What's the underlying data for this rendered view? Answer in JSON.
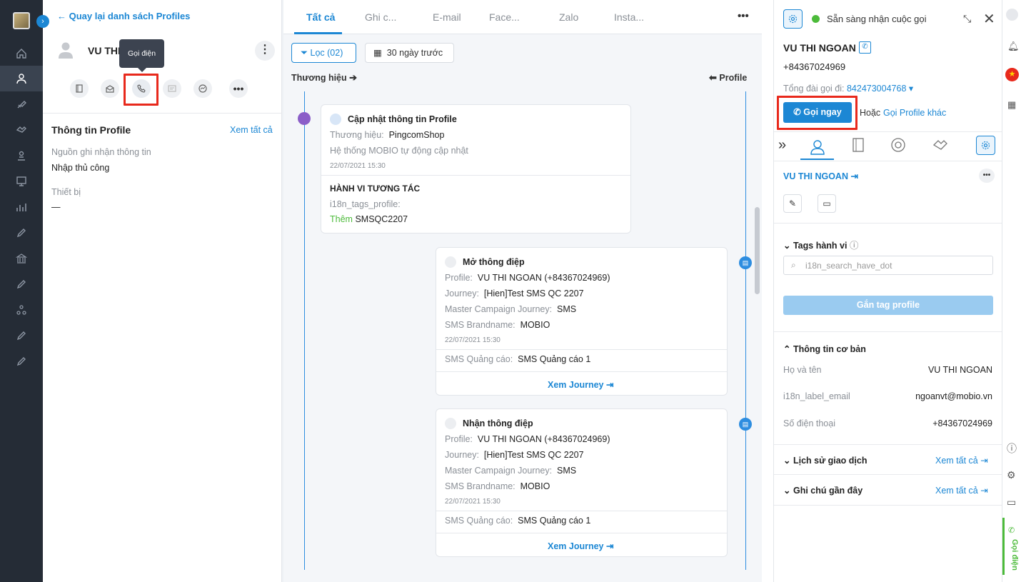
{
  "nav": {
    "back_label": "Quay lại danh sách Profiles"
  },
  "profile": {
    "name_truncated": "VU THI",
    "tooltip": "Gọi điện",
    "info_title": "Thông tin Profile",
    "see_all": "Xem tất cả",
    "source_label": "Nguồn ghi nhận thông tin",
    "source_value": "Nhập thủ công",
    "device_label": "Thiết bị",
    "device_value": "—"
  },
  "tabs": [
    "Tất cả",
    "Ghi c...",
    "E-mail",
    "Face...",
    "Zalo",
    "Insta..."
  ],
  "filters": {
    "filter_label": "Lọc (02)",
    "date_label": "30 ngày trước",
    "brand_label": "Thương hiệu",
    "profile_label": "Profile"
  },
  "timeline": {
    "card1": {
      "title": "Cập nhật thông tin Profile",
      "brand_label": "Thương hiệu:",
      "brand_value": "PingcomShop",
      "desc": "Hệ thống MOBIO tự động cập nhật",
      "time": "22/07/2021 15:30",
      "section_title": "HÀNH VI TƯƠNG TÁC",
      "tags_label": "i18n_tags_profile:",
      "add_label": "Thêm",
      "tag_value": "SMSQC2207"
    },
    "card2": {
      "title": "Mở thông điệp",
      "profile_label": "Profile:",
      "profile_value": "VU THI NGOAN (+84367024969)",
      "journey_label": "Journey:",
      "journey_value": "[Hien]Test SMS QC 2207",
      "master_label": "Master Campaign Journey:",
      "master_value": "SMS",
      "brandname_label": "SMS Brandname:",
      "brandname_value": "MOBIO",
      "time": "22/07/2021 15:30",
      "ad_label": "SMS Quảng cáo:",
      "ad_value": "SMS Quảng cáo 1",
      "link": "Xem Journey"
    },
    "card3": {
      "title": "Nhận thông điệp",
      "profile_label": "Profile:",
      "profile_value": "VU THI NGOAN (+84367024969)",
      "journey_label": "Journey:",
      "journey_value": "[Hien]Test SMS QC 2207",
      "master_label": "Master Campaign Journey:",
      "master_value": "SMS",
      "brandname_label": "SMS Brandname:",
      "brandname_value": "MOBIO",
      "time": "22/07/2021 15:30",
      "ad_label": "SMS Quảng cáo:",
      "ad_value": "SMS Quảng cáo 1",
      "link": "Xem Journey"
    }
  },
  "call": {
    "status": "Sẵn sàng nhận cuộc gọi",
    "name": "VU THI NGOAN",
    "phone": "+84367024969",
    "hotline_label": "Tổng đài gọi đi:",
    "hotline_value": "842473004768",
    "call_now": "Gọi ngay",
    "or": "Hoặc",
    "other_profile": "Gọi Profile khác",
    "profile_link": "VU THI NGOAN",
    "tags_title": "Tags hành vi",
    "search_placeholder": "i18n_search_have_dot",
    "tag_button": "Gắn tag profile",
    "basic_title": "Thông tin cơ bản",
    "fullname_label": "Họ và tên",
    "fullname_value": "VU THI NGOAN",
    "email_label": "i18n_label_email",
    "email_value": "ngoanvt@mobio.vn",
    "phone_label": "Số điện thoại",
    "phone_value": "+84367024969",
    "history_title": "Lịch sử giao dịch",
    "notes_title": "Ghi chú gần đây",
    "see_all": "Xem tất cả"
  },
  "side": {
    "call_tab": "Gọi điện"
  },
  "colors": {
    "accent": "#1c87d4",
    "highlight": "#e8291c",
    "ready": "#4cbb3a"
  }
}
